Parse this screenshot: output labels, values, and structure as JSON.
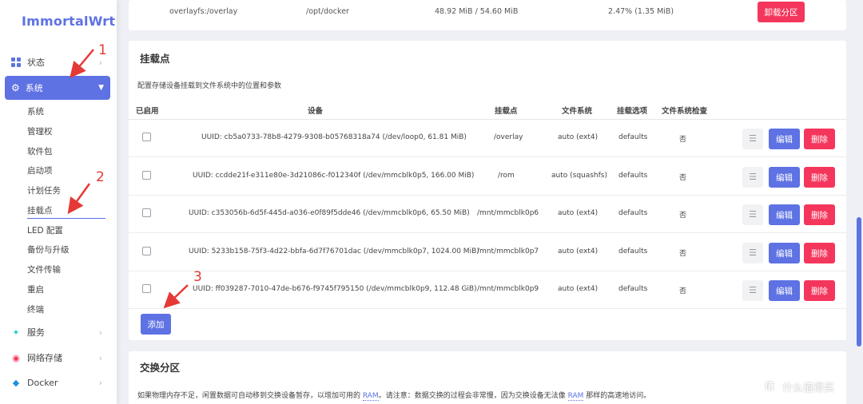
{
  "brand": "ImmortalWrt",
  "sidebar": {
    "status": "状态",
    "system": "系统",
    "sub_items": [
      "系统",
      "管理权",
      "软件包",
      "启动项",
      "计划任务",
      "挂载点",
      "LED 配置",
      "备份与升级",
      "文件传输",
      "重启",
      "终端"
    ],
    "groups": [
      "服务",
      "网络存储",
      "Docker"
    ]
  },
  "top_row": {
    "filesystem": "overlayfs:/overlay",
    "mount": "/opt/docker",
    "usage": "48.92 MiB / 54.60 MiB",
    "reserved": "2.47% (1.35 MiB)",
    "unmount_label": "卸载分区"
  },
  "mount_section": {
    "title": "挂载点",
    "description": "配置存储设备挂载到文件系统中的位置和参数",
    "columns": [
      "已启用",
      "设备",
      "挂载点",
      "文件系统",
      "挂载选项",
      "文件系统检查"
    ],
    "rows": [
      {
        "device": "UUID: cb5a0733-78b8-4279-9308-b05768318a74 (/dev/loop0, 61.81 MiB)",
        "mount": "/overlay",
        "fs": "auto (ext4)",
        "options": "defaults",
        "check": "否"
      },
      {
        "device": "UUID: ccdde21f-e311e80e-3d21086c-f012340f (/dev/mmcblk0p5, 166.00 MiB)",
        "mount": "/rom",
        "fs": "auto (squashfs)",
        "options": "defaults",
        "check": "否"
      },
      {
        "device": "UUID: c353056b-6d5f-445d-a036-e0f89f5dde46 (/dev/mmcblk0p6, 65.50 MiB)",
        "mount": "/mnt/mmcblk0p6",
        "fs": "auto (ext4)",
        "options": "defaults",
        "check": "否"
      },
      {
        "device": "UUID: 5233b158-75f3-4d22-bbfa-6d7f76701dac (/dev/mmcblk0p7, 1024.00 MiB)",
        "mount": "/mnt/mmcblk0p7",
        "fs": "auto (ext4)",
        "options": "defaults",
        "check": "否"
      },
      {
        "device": "UUID: ff039287-7010-47de-b676-f9745f795150 (/dev/mmcblk0p9, 112.48 GiB)",
        "mount": "/mnt/mmcblk0p9",
        "fs": "auto (ext4)",
        "options": "defaults",
        "check": "否"
      }
    ],
    "edit_label": "编辑",
    "delete_label": "删除",
    "handle_icon": "☰",
    "add_label": "添加"
  },
  "swap_section": {
    "title": "交换分区",
    "desc_part1": "如果物理内存不足，闲置数据可自动移到交换设备暂存，以增加可用的 ",
    "ram1": "RAM",
    "desc_part2": "。请注意：数据交换的过程会非常慢，因为交换设备无法像 ",
    "ram2": "RAM",
    "desc_part3": " 那样的高速地访问。"
  },
  "annotations": [
    "1",
    "2",
    "3"
  ],
  "watermark": "什么值得买",
  "watermark_logo": "值",
  "colors": {
    "accent": "#5e72e4",
    "danger": "#f5365c",
    "annotation": "#e53935"
  }
}
